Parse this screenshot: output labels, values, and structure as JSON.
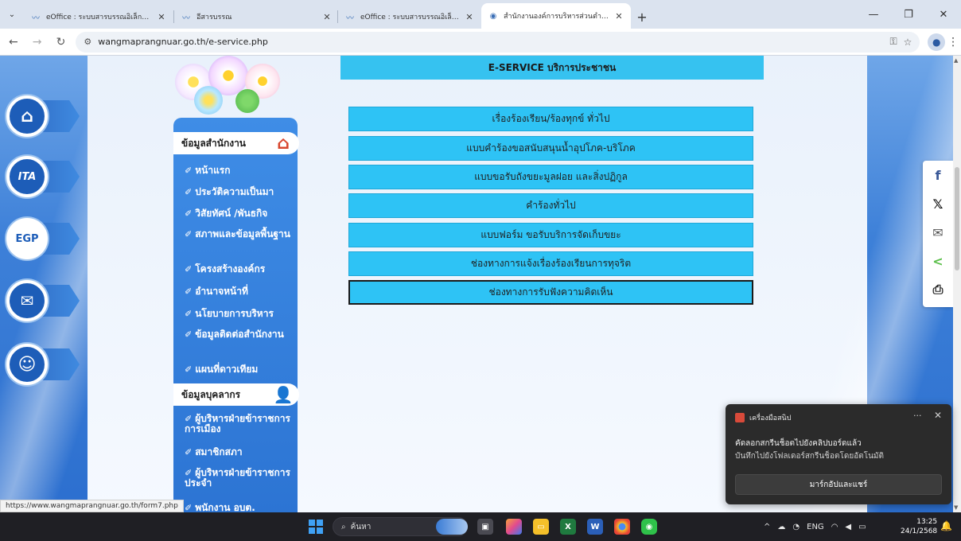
{
  "browser": {
    "tabs": [
      {
        "title": "eOffice : ระบบสารบรรณอิเล็กทรอนิก",
        "icon": "eoffice-icon",
        "active": false
      },
      {
        "title": "อีสารบรรณ",
        "icon": "eoffice-icon",
        "active": false
      },
      {
        "title": "eOffice : ระบบสารบรรณอิเล็กทรอนิก",
        "icon": "eoffice-icon",
        "active": false
      },
      {
        "title": "สำนักงานองค์การบริหารส่วนตำบลวัง",
        "icon": "globe-icon",
        "active": true
      }
    ],
    "url": "wangmaprangnuar.go.th/e-service.php",
    "status_url": "https://www.wangmaprangnuar.go.th/form7.php"
  },
  "left_icons": [
    "home-icon",
    "ITA",
    "EGP",
    "mail-icon",
    "user-icon"
  ],
  "sidemenu": {
    "section1": "ข้อมูลสำนักงาน",
    "items1": [
      "หน้าแรก",
      "ประวัติความเป็นมา",
      "วิสัยทัศน์ /พันธกิจ",
      "สภาพและข้อมูลพื้นฐาน",
      "โครงสร้างองค์กร",
      "อำนาจหน้าที่",
      "นโยบายการบริหาร",
      "ข้อมูลติดต่อสำนักงาน",
      "แผนที่ดาวเทียม"
    ],
    "section2": "ข้อมูลบุคลากร",
    "items2": [
      "ผู้บริหารฝ่ายข้าราชการการเมือง",
      "สมาชิกสภา",
      "ผู้บริหารฝ่ายข้าราชการประจำ",
      "พนักงาน อบต."
    ]
  },
  "eservice": {
    "header": "E-SERVICE บริการประชาชน",
    "buttons": [
      "เรื่องร้องเรียน/ร้องทุกข์ ทั่วไป",
      "แบบคำร้องขอสนับสนุนน้ำอุปโภค-บริโภค",
      "แบบขอรับถังขยะมูลฝอย และสิ่งปฏิกูล",
      "คำร้องทั่วไป",
      "แบบฟอร์ม ขอรับบริการจัดเก็บขยะ",
      "ช่องทางการแจ้งเรื่องร้องเรียนการทุจริต",
      "ช่องทางการรับฟังความคิดเห็น"
    ]
  },
  "share": [
    "facebook-icon",
    "x-icon",
    "email-icon",
    "share-icon",
    "print-icon"
  ],
  "notification": {
    "app": "เครื่องมือสนิป",
    "line1": "คัดลอกสกรีนช็อตไปยังคลิปบอร์ดแล้ว",
    "line2": "บันทึกไปยังโฟลเดอร์สกรีนช็อตโดยอัตโนมัติ",
    "action": "มาร์กอัปและแชร์"
  },
  "taskbar": {
    "search_placeholder": "ค้นหา",
    "lang": "ENG",
    "time": "13:25",
    "date": "24/1/2568"
  }
}
